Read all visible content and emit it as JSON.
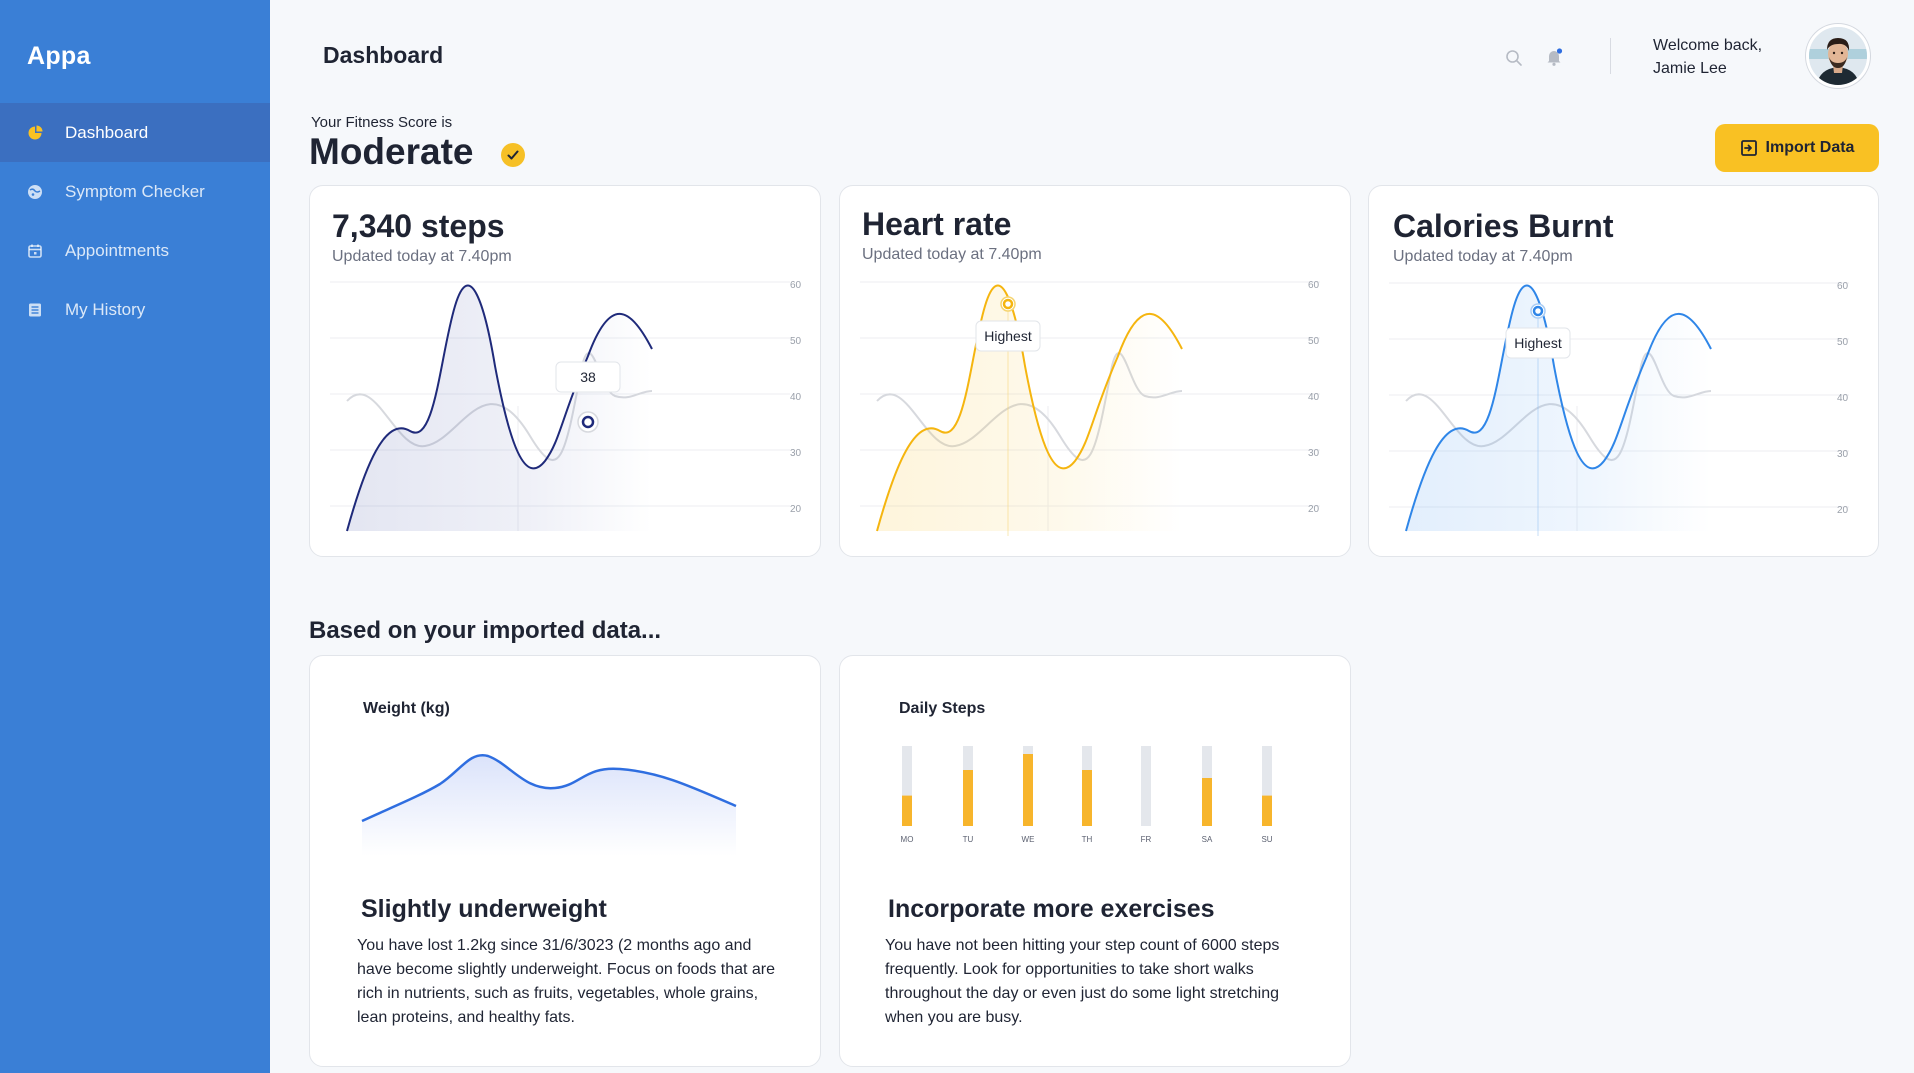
{
  "app": {
    "name": "Appa"
  },
  "sidebar": {
    "items": [
      {
        "label": "Dashboard",
        "icon": "pie-chart-icon",
        "active": true
      },
      {
        "label": "Symptom Checker",
        "icon": "globe-icon",
        "active": false
      },
      {
        "label": "Appointments",
        "icon": "calendar-icon",
        "active": false
      },
      {
        "label": "My History",
        "icon": "document-list-icon",
        "active": false
      }
    ]
  },
  "header": {
    "title": "Dashboard",
    "welcome_line1": "Welcome back,",
    "welcome_line2": "Jamie Lee",
    "icons": [
      "search-icon",
      "bell-icon"
    ]
  },
  "fitness": {
    "label": "Your Fitness Score is",
    "value": "Moderate",
    "import_label": "Import Data"
  },
  "stats": [
    {
      "title": "7,340 steps",
      "updated": "Updated today at 7.40pm",
      "tooltip": "38",
      "color": "#1f2a7a"
    },
    {
      "title": "Heart rate",
      "updated": "Updated today at 7.40pm",
      "tooltip": "Highest",
      "color": "#f5b50f"
    },
    {
      "title": "Calories Burnt",
      "updated": "Updated today at 7.40pm",
      "tooltip": "Highest",
      "color": "#2f86e8"
    }
  ],
  "axis_ticks": [
    "60",
    "50",
    "40",
    "30",
    "20"
  ],
  "section_title": "Based on your imported data...",
  "weight": {
    "title": "Weight (kg)",
    "insight_title": "Slightly underweight",
    "insight_text": "You have lost 1.2kg since 31/6/3023 (2 months ago and have become slightly underweight. Focus on foods that are rich in nutrients, such as fruits, vegetables, whole grains, lean proteins, and healthy fats."
  },
  "daily_steps": {
    "title": "Daily Steps",
    "insight_title": "Incorporate more exercises",
    "insight_text": "You have not been hitting your step count of 6000 steps frequently. Look for opportunities to take short walks throughout the day or even just do some light stretching when you are busy.",
    "days": [
      "MO",
      "TU",
      "WE",
      "TH",
      "FR",
      "SA",
      "SU"
    ],
    "levels": [
      0.38,
      0.7,
      0.9,
      0.7,
      0,
      0.6,
      0.38
    ]
  },
  "colors": {
    "sidebar": "#3a7fd6",
    "accent": "#f9c123",
    "background": "#f6f8fb"
  }
}
